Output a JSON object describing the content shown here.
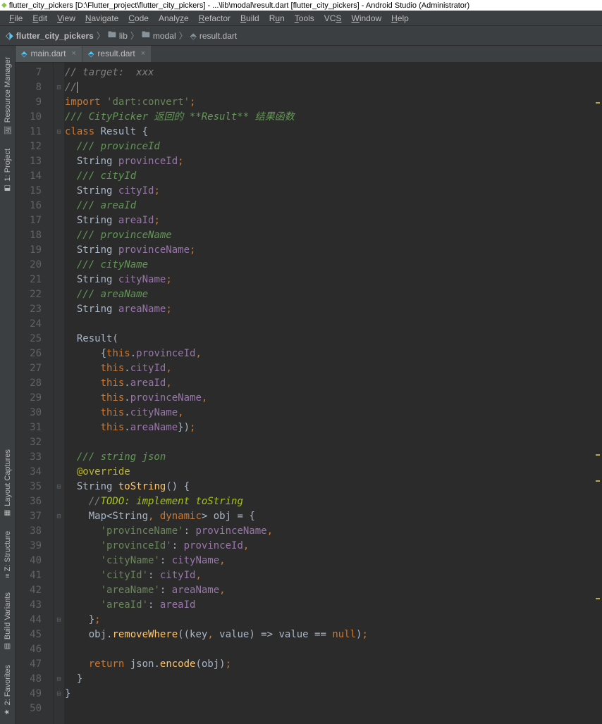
{
  "window": {
    "title": "flutter_city_pickers [D:\\Flutter_project\\flutter_city_pickers] - ...\\lib\\modal\\result.dart [flutter_city_pickers] - Android Studio (Administrator)"
  },
  "menu": {
    "items": [
      "File",
      "Edit",
      "View",
      "Navigate",
      "Code",
      "Analyze",
      "Refactor",
      "Build",
      "Run",
      "Tools",
      "VCS",
      "Window",
      "Help"
    ]
  },
  "breadcrumbs": {
    "project": "flutter_city_pickers",
    "folder1": "lib",
    "folder2": "modal",
    "file": "result.dart"
  },
  "tabs": [
    {
      "name": "main.dart",
      "active": false
    },
    {
      "name": "result.dart",
      "active": true
    }
  ],
  "tools": {
    "resource_manager": "Resource Manager",
    "project": "1: Project",
    "layout_captures": "Layout Captures",
    "structure": "Z: Structure",
    "build_variants": "Build Variants",
    "favorites": "2: Favorites"
  },
  "code": {
    "lines": [
      {
        "n": 7,
        "fold": " ",
        "tokens": [
          [
            "c-cmt",
            "// target:  xxx"
          ]
        ]
      },
      {
        "n": 8,
        "fold": "⊖",
        "tokens": [
          [
            "c-cmt",
            "//"
          ],
          [
            "caret",
            ""
          ]
        ]
      },
      {
        "n": 9,
        "fold": " ",
        "tokens": [
          [
            "c-kw",
            "import "
          ],
          [
            "c-str",
            "'dart:convert'"
          ],
          [
            "c-punct",
            ";"
          ]
        ]
      },
      {
        "n": 10,
        "fold": " ",
        "tokens": [
          [
            "c-doc",
            "/// CityPicker 返回的 **Result** 结果函数"
          ]
        ]
      },
      {
        "n": 11,
        "fold": "⊖",
        "tokens": [
          [
            "c-kw",
            "class "
          ],
          [
            "c-cls",
            "Result {"
          ]
        ]
      },
      {
        "n": 12,
        "fold": " ",
        "tokens": [
          [
            "",
            "  "
          ],
          [
            "c-doc",
            "/// provinceId"
          ]
        ]
      },
      {
        "n": 13,
        "fold": " ",
        "tokens": [
          [
            "",
            "  "
          ],
          [
            "c-type",
            "String "
          ],
          [
            "c-field",
            "provinceId"
          ],
          [
            "c-punct",
            ";"
          ]
        ]
      },
      {
        "n": 14,
        "fold": " ",
        "tokens": [
          [
            "",
            "  "
          ],
          [
            "c-doc",
            "/// cityId"
          ]
        ]
      },
      {
        "n": 15,
        "fold": " ",
        "tokens": [
          [
            "",
            "  "
          ],
          [
            "c-type",
            "String "
          ],
          [
            "c-field",
            "cityId"
          ],
          [
            "c-punct",
            ";"
          ]
        ]
      },
      {
        "n": 16,
        "fold": " ",
        "tokens": [
          [
            "",
            "  "
          ],
          [
            "c-doc",
            "/// areaId"
          ]
        ]
      },
      {
        "n": 17,
        "fold": " ",
        "tokens": [
          [
            "",
            "  "
          ],
          [
            "c-type",
            "String "
          ],
          [
            "c-field",
            "areaId"
          ],
          [
            "c-punct",
            ";"
          ]
        ]
      },
      {
        "n": 18,
        "fold": " ",
        "tokens": [
          [
            "",
            "  "
          ],
          [
            "c-doc",
            "/// provinceName"
          ]
        ]
      },
      {
        "n": 19,
        "fold": " ",
        "tokens": [
          [
            "",
            "  "
          ],
          [
            "c-type",
            "String "
          ],
          [
            "c-field",
            "provinceName"
          ],
          [
            "c-punct",
            ";"
          ]
        ]
      },
      {
        "n": 20,
        "fold": " ",
        "tokens": [
          [
            "",
            "  "
          ],
          [
            "c-doc",
            "/// cityName"
          ]
        ]
      },
      {
        "n": 21,
        "fold": " ",
        "tokens": [
          [
            "",
            "  "
          ],
          [
            "c-type",
            "String "
          ],
          [
            "c-field",
            "cityName"
          ],
          [
            "c-punct",
            ";"
          ]
        ]
      },
      {
        "n": 22,
        "fold": " ",
        "tokens": [
          [
            "",
            "  "
          ],
          [
            "c-doc",
            "/// areaName"
          ]
        ]
      },
      {
        "n": 23,
        "fold": " ",
        "tokens": [
          [
            "",
            "  "
          ],
          [
            "c-type",
            "String "
          ],
          [
            "c-field",
            "areaName"
          ],
          [
            "c-punct",
            ";"
          ]
        ]
      },
      {
        "n": 24,
        "fold": " ",
        "tokens": [
          [
            "",
            ""
          ]
        ]
      },
      {
        "n": 25,
        "fold": " ",
        "tokens": [
          [
            "",
            "  Result("
          ]
        ]
      },
      {
        "n": 26,
        "fold": " ",
        "tokens": [
          [
            "",
            "      {"
          ],
          [
            "c-this",
            "this"
          ],
          [
            "",
            "."
          ],
          [
            "c-field",
            "provinceId"
          ],
          [
            "c-punct",
            ","
          ]
        ]
      },
      {
        "n": 27,
        "fold": " ",
        "tokens": [
          [
            "",
            "      "
          ],
          [
            "c-this",
            "this"
          ],
          [
            "",
            "."
          ],
          [
            "c-field",
            "cityId"
          ],
          [
            "c-punct",
            ","
          ]
        ]
      },
      {
        "n": 28,
        "fold": " ",
        "tokens": [
          [
            "",
            "      "
          ],
          [
            "c-this",
            "this"
          ],
          [
            "",
            "."
          ],
          [
            "c-field",
            "areaId"
          ],
          [
            "c-punct",
            ","
          ]
        ]
      },
      {
        "n": 29,
        "fold": " ",
        "tokens": [
          [
            "",
            "      "
          ],
          [
            "c-this",
            "this"
          ],
          [
            "",
            "."
          ],
          [
            "c-field",
            "provinceName"
          ],
          [
            "c-punct",
            ","
          ]
        ]
      },
      {
        "n": 30,
        "fold": " ",
        "tokens": [
          [
            "",
            "      "
          ],
          [
            "c-this",
            "this"
          ],
          [
            "",
            "."
          ],
          [
            "c-field",
            "cityName"
          ],
          [
            "c-punct",
            ","
          ]
        ]
      },
      {
        "n": 31,
        "fold": " ",
        "tokens": [
          [
            "",
            "      "
          ],
          [
            "c-this",
            "this"
          ],
          [
            "",
            "."
          ],
          [
            "c-field",
            "areaName"
          ],
          [
            "",
            "})"
          ],
          [
            "c-punct",
            ";"
          ]
        ]
      },
      {
        "n": 32,
        "fold": " ",
        "tokens": [
          [
            "",
            ""
          ]
        ]
      },
      {
        "n": 33,
        "fold": " ",
        "tokens": [
          [
            "",
            "  "
          ],
          [
            "c-doc",
            "/// string json"
          ]
        ]
      },
      {
        "n": 34,
        "fold": " ",
        "tokens": [
          [
            "",
            "  "
          ],
          [
            "c-anno",
            "@override"
          ]
        ]
      },
      {
        "n": 35,
        "fold": "⊖",
        "tokens": [
          [
            "",
            "  "
          ],
          [
            "c-type",
            "String "
          ],
          [
            "c-method",
            "toString"
          ],
          [
            "",
            "() {"
          ]
        ]
      },
      {
        "n": 36,
        "fold": " ",
        "tokens": [
          [
            "",
            "    "
          ],
          [
            "c-cmt",
            "//"
          ],
          [
            "c-todo",
            "TODO: implement toString"
          ]
        ]
      },
      {
        "n": 37,
        "fold": "⊖",
        "tokens": [
          [
            "",
            "    Map<String"
          ],
          [
            "c-punct",
            ", "
          ],
          [
            "c-kw",
            "dynamic"
          ],
          [
            "",
            "> obj = {"
          ]
        ]
      },
      {
        "n": 38,
        "fold": " ",
        "tokens": [
          [
            "",
            "      "
          ],
          [
            "c-str",
            "'provinceName'"
          ],
          [
            "",
            ": "
          ],
          [
            "c-field",
            "provinceName"
          ],
          [
            "c-punct",
            ","
          ]
        ]
      },
      {
        "n": 39,
        "fold": " ",
        "tokens": [
          [
            "",
            "      "
          ],
          [
            "c-str",
            "'provinceId'"
          ],
          [
            "",
            ": "
          ],
          [
            "c-field",
            "provinceId"
          ],
          [
            "c-punct",
            ","
          ]
        ]
      },
      {
        "n": 40,
        "fold": " ",
        "tokens": [
          [
            "",
            "      "
          ],
          [
            "c-str",
            "'cityName'"
          ],
          [
            "",
            ": "
          ],
          [
            "c-field",
            "cityName"
          ],
          [
            "c-punct",
            ","
          ]
        ]
      },
      {
        "n": 41,
        "fold": " ",
        "tokens": [
          [
            "",
            "      "
          ],
          [
            "c-str",
            "'cityId'"
          ],
          [
            "",
            ": "
          ],
          [
            "c-field",
            "cityId"
          ],
          [
            "c-punct",
            ","
          ]
        ]
      },
      {
        "n": 42,
        "fold": " ",
        "tokens": [
          [
            "",
            "      "
          ],
          [
            "c-str",
            "'areaName'"
          ],
          [
            "",
            ": "
          ],
          [
            "c-field",
            "areaName"
          ],
          [
            "c-punct",
            ","
          ]
        ]
      },
      {
        "n": 43,
        "fold": " ",
        "tokens": [
          [
            "",
            "      "
          ],
          [
            "c-str",
            "'areaId'"
          ],
          [
            "",
            ": "
          ],
          [
            "c-field",
            "areaId"
          ]
        ]
      },
      {
        "n": 44,
        "fold": "⊖",
        "tokens": [
          [
            "",
            "    }"
          ],
          [
            "c-punct",
            ";"
          ]
        ]
      },
      {
        "n": 45,
        "fold": " ",
        "tokens": [
          [
            "",
            "    obj."
          ],
          [
            "c-method",
            "removeWhere"
          ],
          [
            "",
            "((key"
          ],
          [
            "c-punct",
            ", "
          ],
          [
            "",
            "value) => value == "
          ],
          [
            "c-kw",
            "null"
          ],
          [
            "",
            ")"
          ],
          [
            "c-punct",
            ";"
          ]
        ]
      },
      {
        "n": 46,
        "fold": " ",
        "tokens": [
          [
            "",
            ""
          ]
        ]
      },
      {
        "n": 47,
        "fold": " ",
        "tokens": [
          [
            "",
            "    "
          ],
          [
            "c-kw",
            "return "
          ],
          [
            "",
            "json."
          ],
          [
            "c-method",
            "encode"
          ],
          [
            "",
            "(obj)"
          ],
          [
            "c-punct",
            ";"
          ]
        ]
      },
      {
        "n": 48,
        "fold": "⊖",
        "tokens": [
          [
            "",
            "  }"
          ]
        ]
      },
      {
        "n": 49,
        "fold": "⊖",
        "tokens": [
          [
            "",
            "}"
          ]
        ]
      },
      {
        "n": 50,
        "fold": " ",
        "tokens": [
          [
            "",
            ""
          ]
        ]
      }
    ]
  }
}
